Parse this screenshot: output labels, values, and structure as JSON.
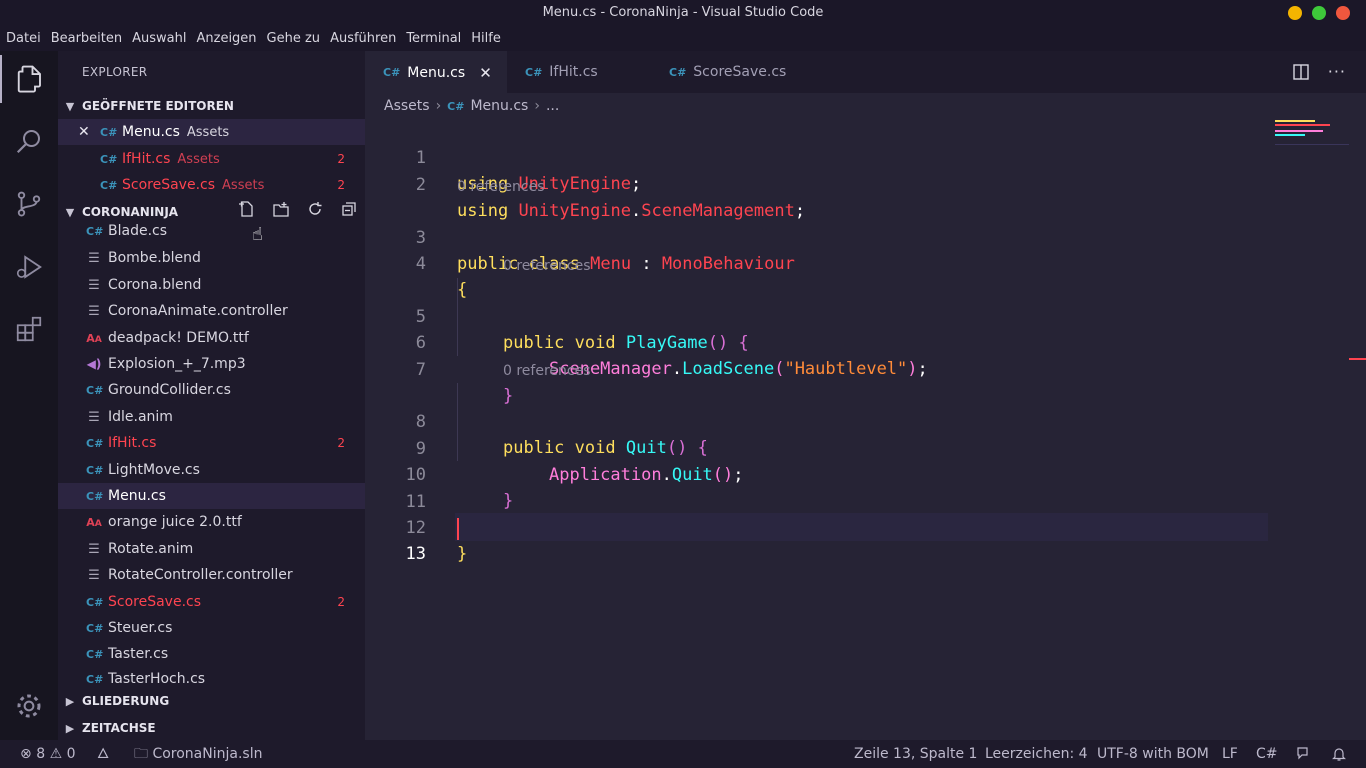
{
  "window": {
    "title": "Menu.cs - CoronaNinja - Visual Studio Code"
  },
  "menu": [
    "Datei",
    "Bearbeiten",
    "Auswahl",
    "Anzeigen",
    "Gehe zu",
    "Ausführen",
    "Terminal",
    "Hilfe"
  ],
  "sidebar": {
    "title": "EXPLORER",
    "open_editors": {
      "label": "GEÖFFNETE EDITOREN",
      "items": [
        {
          "name": "Menu.cs",
          "folder": "Assets",
          "badge": ""
        },
        {
          "name": "IfHit.cs",
          "folder": "Assets",
          "badge": "2"
        },
        {
          "name": "ScoreSave.cs",
          "folder": "Assets",
          "badge": "2"
        }
      ]
    },
    "project": {
      "label": "CORONANINJA",
      "files": [
        {
          "name": "Blade.cs",
          "icon": "csharp-icon",
          "badge": ""
        },
        {
          "name": "Bombe.blend",
          "icon": "file-lines-icon",
          "badge": ""
        },
        {
          "name": "Corona.blend",
          "icon": "file-lines-icon",
          "badge": ""
        },
        {
          "name": "CoronaAnimate.controller",
          "icon": "file-lines-icon",
          "badge": ""
        },
        {
          "name": "deadpack! DEMO.ttf",
          "icon": "font-icon",
          "badge": ""
        },
        {
          "name": "Explosion_+_7.mp3",
          "icon": "audio-icon",
          "badge": ""
        },
        {
          "name": "GroundCollider.cs",
          "icon": "csharp-icon",
          "badge": ""
        },
        {
          "name": "Idle.anim",
          "icon": "file-lines-icon",
          "badge": ""
        },
        {
          "name": "IfHit.cs",
          "icon": "csharp-icon",
          "badge": "2"
        },
        {
          "name": "LightMove.cs",
          "icon": "csharp-icon",
          "badge": ""
        },
        {
          "name": "Menu.cs",
          "icon": "csharp-icon",
          "badge": ""
        },
        {
          "name": "orange juice 2.0.ttf",
          "icon": "font-icon",
          "badge": ""
        },
        {
          "name": "Rotate.anim",
          "icon": "file-lines-icon",
          "badge": ""
        },
        {
          "name": "RotateController.controller",
          "icon": "file-lines-icon",
          "badge": ""
        },
        {
          "name": "ScoreSave.cs",
          "icon": "csharp-icon",
          "badge": "2"
        },
        {
          "name": "Steuer.cs",
          "icon": "csharp-icon",
          "badge": ""
        },
        {
          "name": "Taster.cs",
          "icon": "csharp-icon",
          "badge": ""
        },
        {
          "name": "TasterHoch.cs",
          "icon": "csharp-icon",
          "badge": ""
        }
      ]
    },
    "outline_label": "GLIEDERUNG",
    "timeline_label": "ZEITACHSE"
  },
  "tabs": [
    {
      "label": "Menu.cs",
      "active": true
    },
    {
      "label": "IfHit.cs",
      "active": false
    },
    {
      "label": "ScoreSave.cs",
      "active": false
    }
  ],
  "breadcrumb": {
    "folder": "Assets",
    "file": "Menu.cs",
    "more": "..."
  },
  "code": {
    "lens": "0 references",
    "line_numbers": [
      "1",
      "2",
      "3",
      "4",
      "5",
      "6",
      "7",
      "8",
      "9",
      "10",
      "11",
      "12",
      "13"
    ],
    "line1": {
      "kw": "using",
      "ns": "UnityEngine",
      "end": ";"
    },
    "line2": {
      "kw": "using",
      "ns1": "UnityEngine",
      "dot": ".",
      "ns2": "SceneManagement",
      "end": ";"
    },
    "line3": {
      "kw1": "public",
      "kw2": "class",
      "name": "Menu",
      "colon": ":",
      "base": "MonoBehaviour"
    },
    "line4": "{",
    "line5": {
      "kw1": "public",
      "kw2": "void",
      "fn": "PlayGame",
      "parens": "()",
      "brace": "{"
    },
    "line6": {
      "obj": "SceneManager",
      "dot": ".",
      "fn": "LoadScene",
      "open": "(",
      "str": "\"Haubtlevel\"",
      "close": ")",
      "end": ";"
    },
    "line7": "}",
    "line8": {
      "kw1": "public",
      "kw2": "void",
      "fn": "Quit",
      "parens": "()",
      "brace": "{"
    },
    "line9": {
      "obj": "Application",
      "dot": ".",
      "fn": "Quit",
      "parens": "()",
      "end": ";"
    },
    "line10": "}",
    "line12": "}"
  },
  "status": {
    "errors": "8",
    "warnings": "0",
    "solution": "CoronaNinja.sln",
    "position": "Zeile 13, Spalte 1",
    "indent": "Leerzeichen: 4",
    "encoding": "UTF-8 with BOM",
    "eol": "LF",
    "language": "C#"
  },
  "colors": {
    "accent": "#fe4450",
    "keyword": "#fede5d",
    "function": "#36f9f6",
    "string": "#ff8b39",
    "property": "#ff7edb",
    "background": "#262335"
  }
}
